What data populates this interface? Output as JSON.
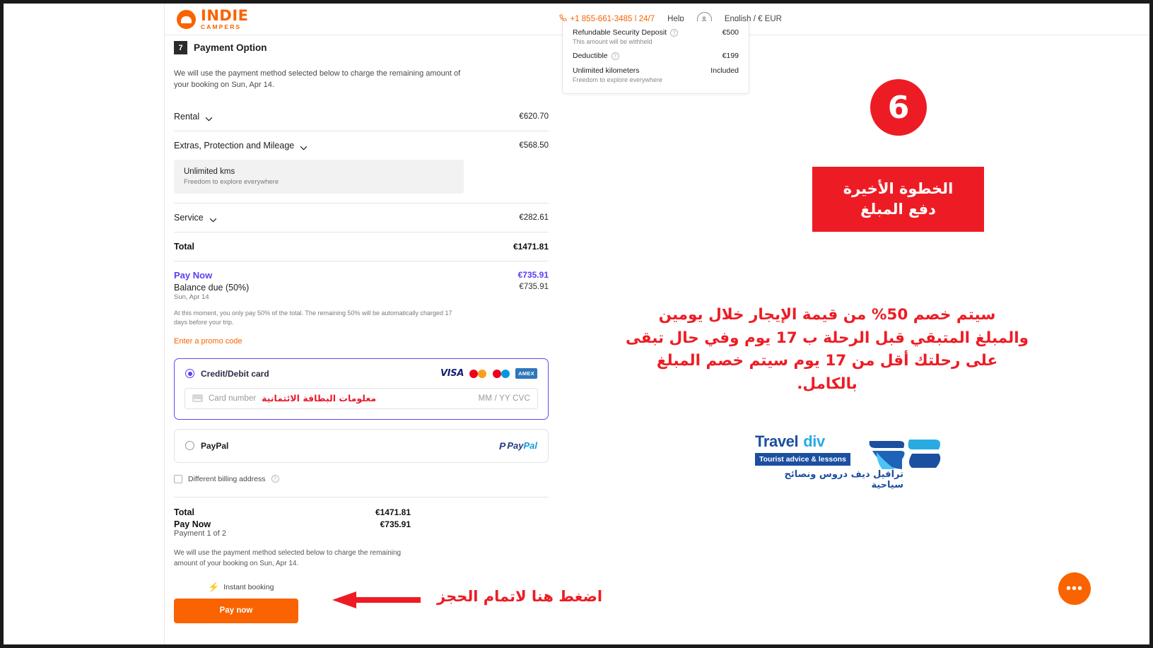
{
  "header": {
    "logo_name": "INDIE",
    "logo_sub": "CAMPERS",
    "phone": "+1 855-661-3485 | 24/7",
    "help": "Help",
    "language": "English / € EUR"
  },
  "step": {
    "number": "7",
    "title": "Payment Option",
    "lead": "We will use the payment method selected below to charge the remaining amount of your booking on Sun, Apr 14."
  },
  "breakdown": [
    {
      "label": "Rental",
      "amount": "€620.70"
    },
    {
      "label": "Extras, Protection and Mileage",
      "amount": "€568.50"
    },
    {
      "label": "Service",
      "amount": "€282.61"
    }
  ],
  "mileage_box": {
    "title": "Unlimited kms",
    "subtitle": "Freedom to explore everywhere"
  },
  "total": {
    "label": "Total",
    "amount": "€1471.81"
  },
  "pay_now": {
    "label": "Pay Now",
    "amount": "€735.91"
  },
  "balance": {
    "label": "Balance due (50%)",
    "amount": "€735.91",
    "date": "Sun, Apr 14"
  },
  "note": "At this moment, you only pay 50% of the total. The remaining 50% will be automatically charged 17 days before your trip.",
  "promo": "Enter a promo code",
  "payment_methods": {
    "credit": {
      "label": "Credit/Debit card",
      "brands": [
        "VISA",
        "mastercard",
        "maestro",
        "AMEX"
      ],
      "card_placeholder": "Card number",
      "card_overlay_ar": "معلومات البطاقة الائتمانية",
      "expiry_cvc": "MM / YY  CVC"
    },
    "paypal": {
      "label": "PayPal",
      "logo_text": "PayPal"
    }
  },
  "billing": {
    "label": "Different billing address"
  },
  "bottom": {
    "total_label": "Total",
    "total_amount": "€1471.81",
    "paynow_label": "Pay Now",
    "paynow_amount": "€735.91",
    "payment_of": "Payment 1 of 2",
    "note": "We will use the payment method selected below to charge the remaining amount of your booking on Sun, Apr 14.",
    "instant": "Instant booking",
    "button": "Pay now"
  },
  "summary_panel": [
    {
      "label": "Refundable Security Deposit",
      "sub": "This amount will be withheld",
      "value": "€500",
      "has_info": true
    },
    {
      "label": "Deductible",
      "sub": "",
      "value": "€199",
      "has_info": true
    },
    {
      "label": "Unlimited kilometers",
      "sub": "Freedom to explore everywhere",
      "value": "Included",
      "has_info": false
    }
  ],
  "annotations": {
    "step_number": "6",
    "banner_line1": "الخطوة الأخيرة",
    "banner_line2": "دفع المبلغ",
    "paragraph_line1": "سيتم خصم 50% من قيمة الإيجار خلال يومين",
    "paragraph_line2": "والمبلغ المتبقي قبل الرحلة ب 17 يوم وفي حال تبقى",
    "paragraph_line3": "على رحلتك أقل من 17 يوم سيتم خصم المبلغ بالكامل.",
    "cta": "اضغط هنا لاتمام الحجز",
    "accent_red": "#ED1C24",
    "accent_orange": "#F96300",
    "accent_purple": "#5B3DF5"
  },
  "watermark": {
    "title_a": "Travel",
    "title_b": "div",
    "subtitle": "Tourist advice & lessons",
    "arabic": "ترافيل ديف  دروس ونصائح سياحية"
  }
}
